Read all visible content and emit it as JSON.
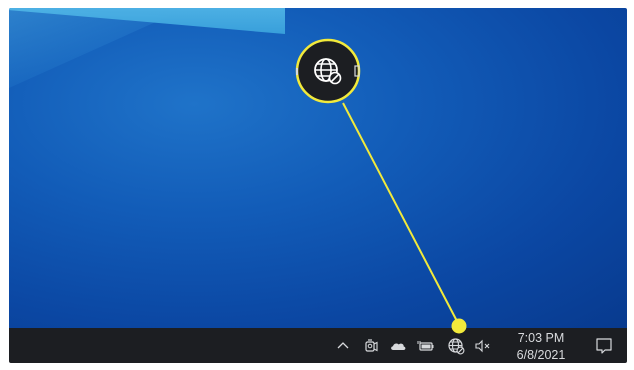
{
  "taskbar": {
    "tray": [
      {
        "name": "show-hidden-icons",
        "icon": "chevron-up-icon"
      },
      {
        "name": "meet-now",
        "icon": "camera-icon"
      },
      {
        "name": "onedrive",
        "icon": "cloud-icon"
      },
      {
        "name": "power",
        "icon": "battery-plug-icon"
      },
      {
        "name": "network",
        "icon": "globe-blocked-icon"
      },
      {
        "name": "volume",
        "icon": "speaker-muted-icon"
      }
    ],
    "time": "7:03 PM",
    "date": "6/8/2021",
    "notifications": {
      "icon": "speech-bubble-icon"
    }
  },
  "callout": {
    "icon": "globe-blocked-icon",
    "color": "#f2ea3b"
  },
  "colors": {
    "taskbar_bg": "#1c1e22",
    "desktop_blue": "#0b47a3",
    "highlight_yellow": "#f2ea3b"
  }
}
